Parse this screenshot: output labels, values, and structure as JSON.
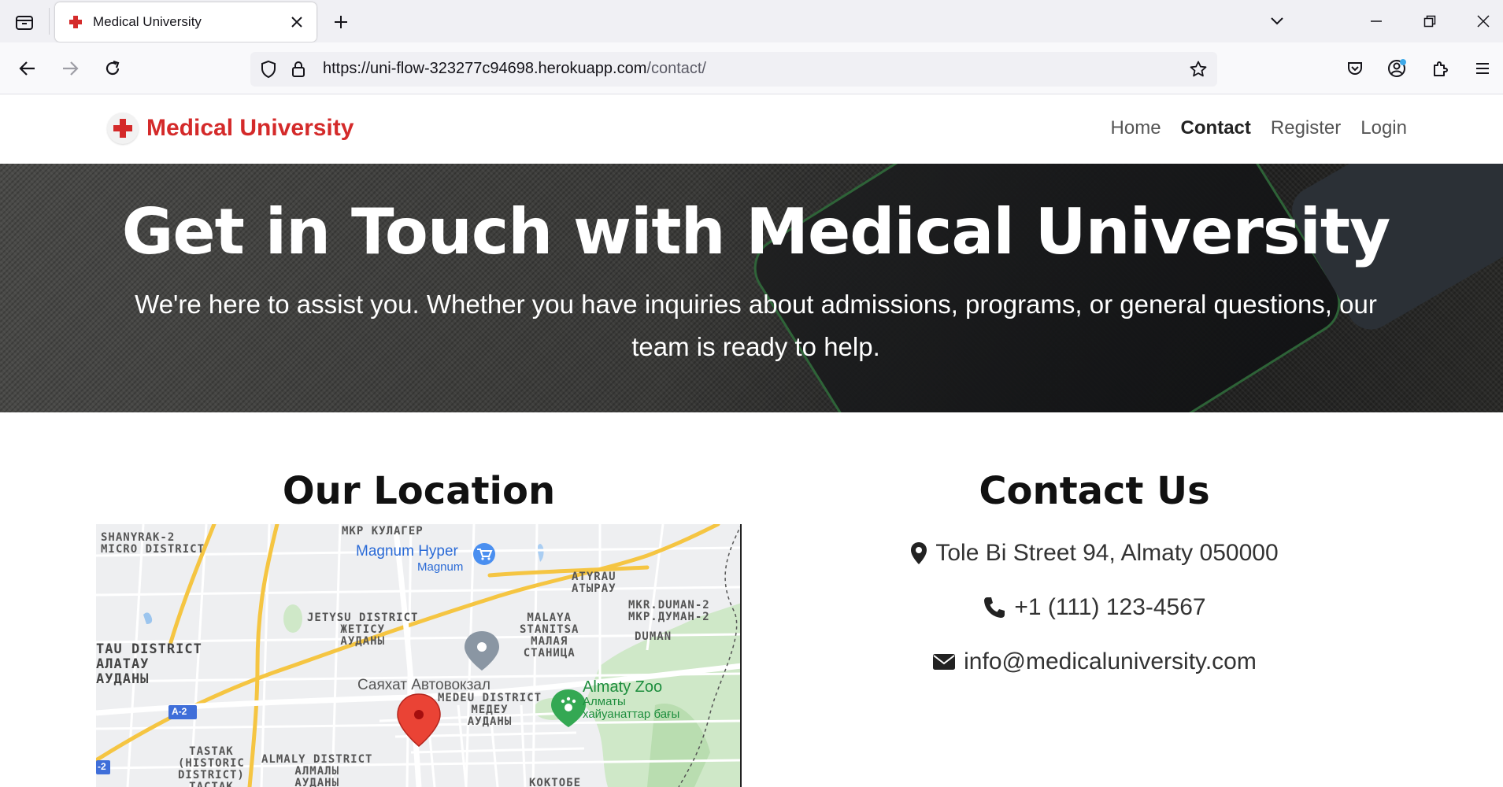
{
  "browser": {
    "tab_title": "Medical University",
    "url_host": "https://uni-flow-323277c94698.herokuapp.com",
    "url_path": "/contact/"
  },
  "site": {
    "brand": "Medical University",
    "nav": [
      {
        "label": "Home",
        "active": false
      },
      {
        "label": "Contact",
        "active": true
      },
      {
        "label": "Register",
        "active": false
      },
      {
        "label": "Login",
        "active": false
      }
    ]
  },
  "hero": {
    "title": "Get in Touch with Medical University",
    "subtitle": "We're here to assist you. Whether you have inquiries about admissions, programs, or general questions, our team is ready to help."
  },
  "location": {
    "title": "Our Location",
    "map_labels": {
      "shanyrak": "SHANYRAK-2\nMICRO DISTRICT",
      "kulager": "МКР КУЛАГЕР",
      "magnum": "Magnum Hyper",
      "magnum_sub": "Magnum",
      "atyrau": "ATYRAU\nАТЫРАУ",
      "jetysu": "JETYSU DISTRICT\nЖЕТІСУ\nАУДАНЫ",
      "malaya": "MALAYA\nSTANITSA\nМАЛАЯ\nСТАНИЦА",
      "duman2": "MKR.DUMAN-2\nМКР.ДУМАН-2",
      "duman": "DUMAN",
      "alatau": "TAU DISTRICT\nАЛАТАУ\nАУДАНЫ",
      "sayakhat": "Саяхат Автовокзал",
      "medeu": "MEDEU DISTRICT\nМЕДЕУ\nАУДАНЫ",
      "zoo": "Almaty Zoo",
      "zoo_sub": "Алматы\nхайуанаттар бағы",
      "a2": "A-2",
      "a2b": "-2",
      "tastak": "TASTAK\n(HISTORIC\nDISTRICT)\nТАСТАК",
      "almaly": "ALMALY DISTRICT\nАЛМАЛЫ\nАУДАНЫ",
      "koktobe": "КОКТОБЕ"
    }
  },
  "contact": {
    "title": "Contact Us",
    "address": "Tole Bi Street 94, Almaty 050000",
    "phone": "+1 (111) 123-4567",
    "email": "info@medicaluniversity.com"
  },
  "colors": {
    "brand_red": "#d42a2a",
    "map_road_yellow": "#f5c542",
    "map_park_green": "#c9e7c2"
  }
}
